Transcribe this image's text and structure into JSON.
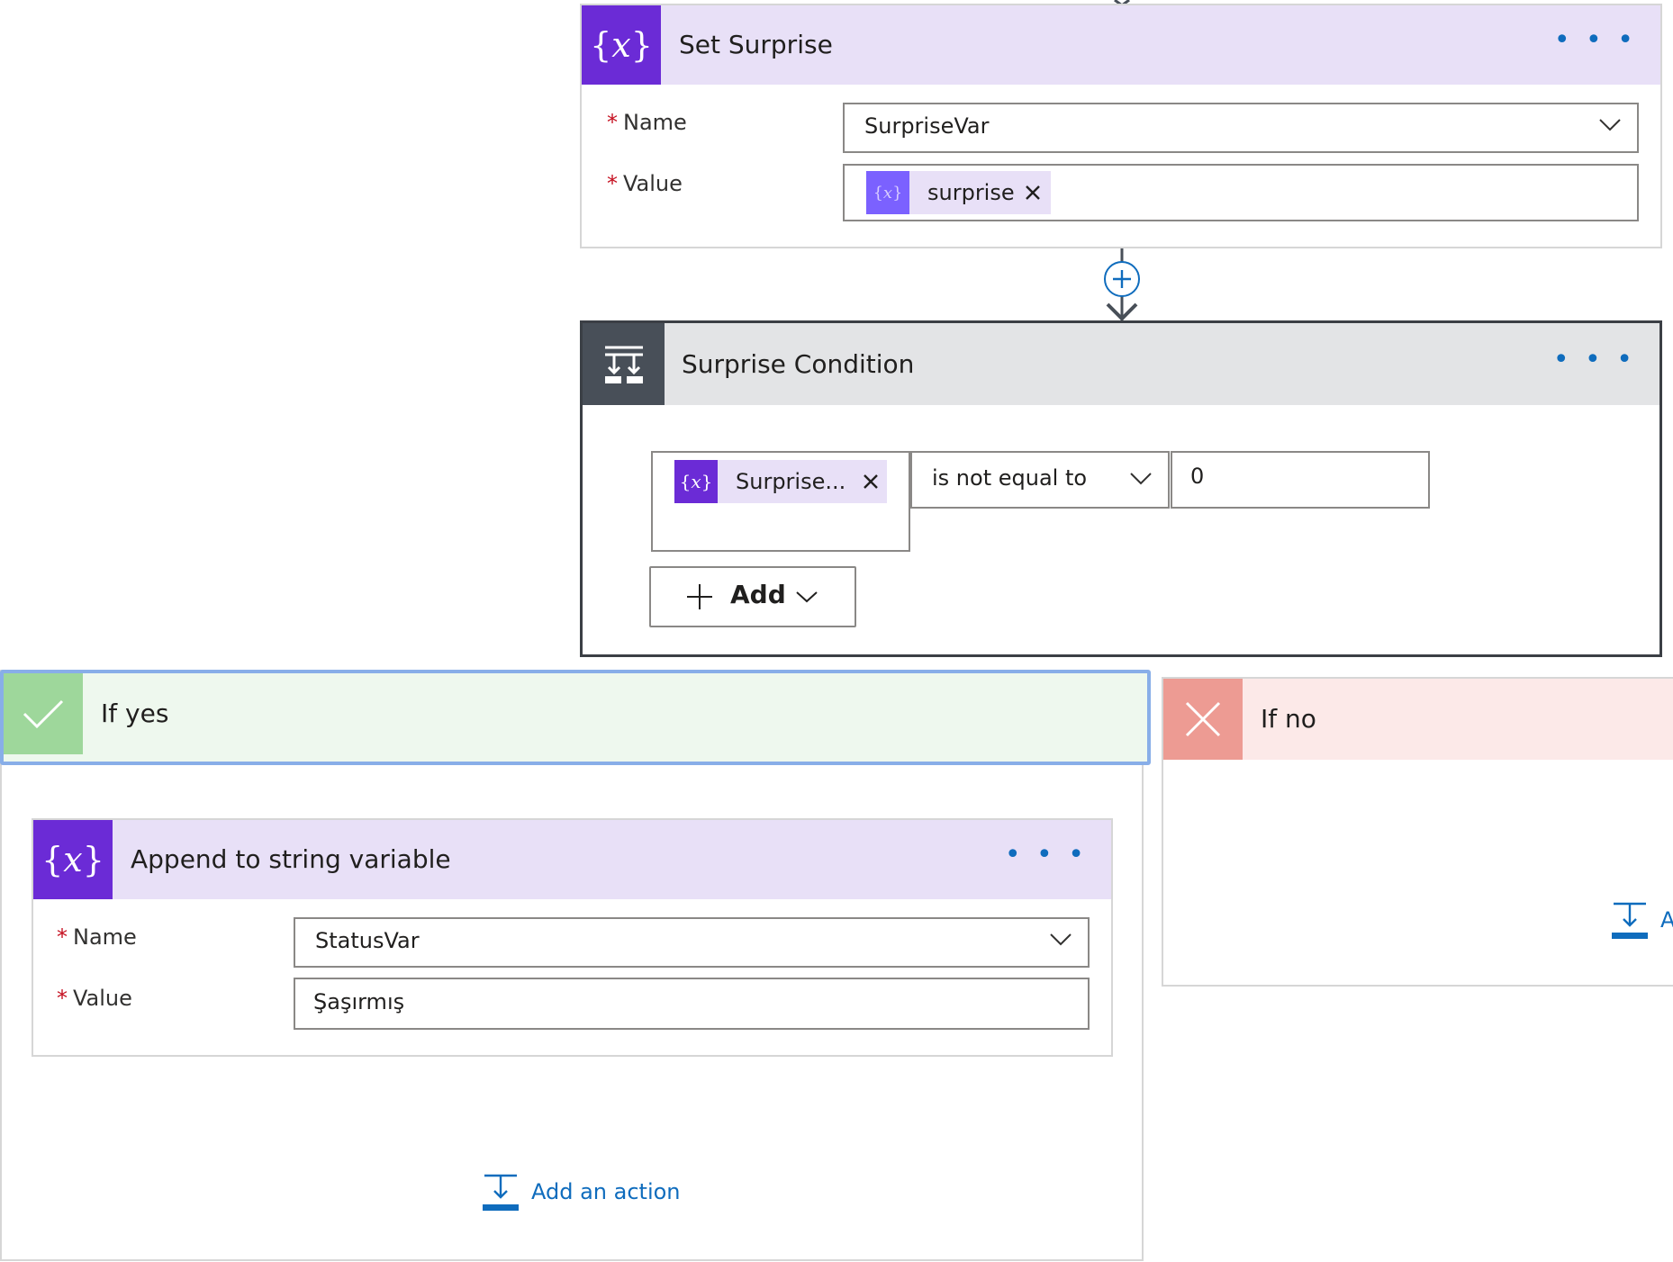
{
  "set_surprise": {
    "title": "Set Surprise",
    "more": "• • •",
    "name_label": "Name",
    "name_value": "SurpriseVar",
    "value_label": "Value",
    "value_token": "surprise",
    "required_mark": "*"
  },
  "condition": {
    "title": "Surprise Condition",
    "more": "• • •",
    "left_token": "Surprise...",
    "operator": "is not equal to",
    "right_value": "0",
    "add_label": "Add"
  },
  "if_yes": {
    "title": "If yes",
    "append": {
      "title": "Append to string variable",
      "more": "• • •",
      "name_label": "Name",
      "name_value": "StatusVar",
      "value_label": "Value",
      "value_text": "Şaşırmış"
    },
    "add_action": "Add an action"
  },
  "if_no": {
    "title": "If no",
    "add_action_partial": "A"
  },
  "colors": {
    "variable_purple": "#6b2bd6",
    "variable_header": "#e8e0f7",
    "condition_dark": "#484f58",
    "condition_header": "#e3e4e6",
    "yes_green": "#9ed79b",
    "yes_header": "#eef8ee",
    "no_red": "#ed9b93",
    "no_header": "#fce9e8",
    "link_blue": "#0f6cbd",
    "focus_blue": "#88aee8"
  }
}
